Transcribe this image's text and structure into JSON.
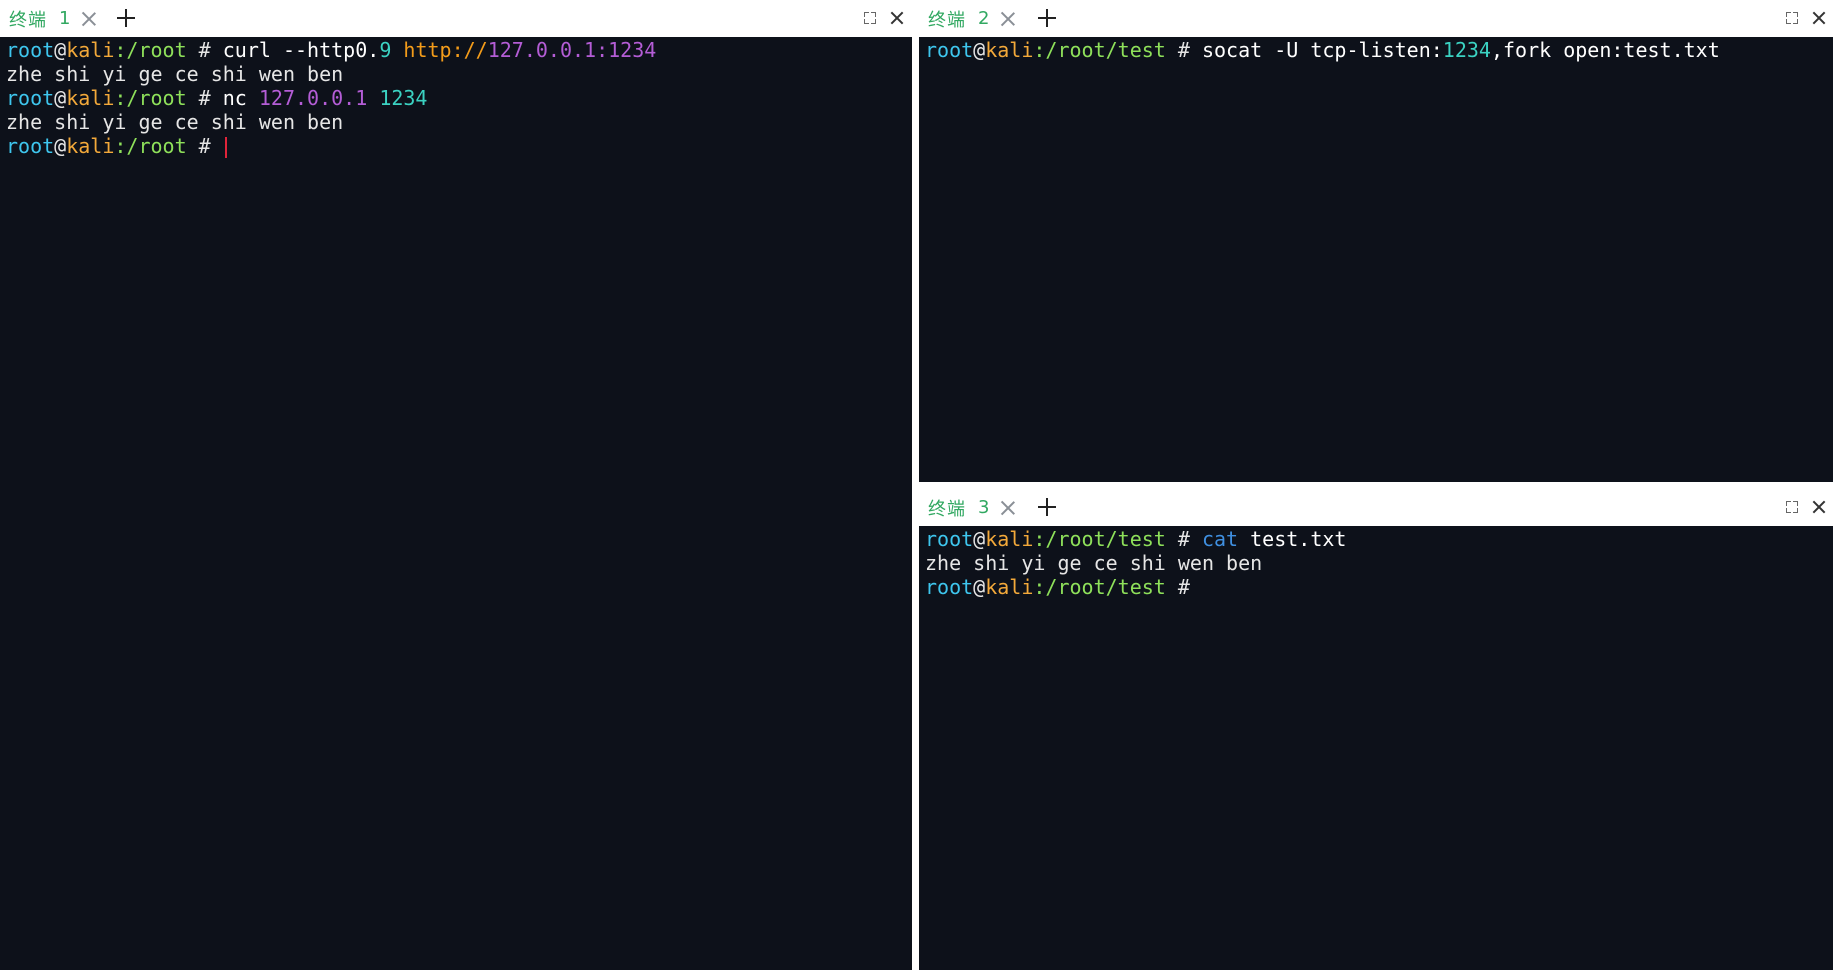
{
  "colors": {
    "terminal_bg": "#0d111a",
    "user": "#3ec6ee",
    "host": "#f3a93a",
    "path": "#8ee05a",
    "tab_label": "#31a861",
    "url": "#f39c1a",
    "ip": "#b45dd6",
    "number": "#3bd2c2",
    "keyword": "#3f8fe0",
    "cursor": "#e0243a"
  },
  "pane1": {
    "tab_label": "终端",
    "tab_number": "1",
    "lines": [
      {
        "prompt": {
          "user": "root",
          "at": "@",
          "host": "kali",
          "path": ":/root",
          "hash": " # "
        },
        "segments": [
          {
            "text": "curl --http0.",
            "style": "cmd"
          },
          {
            "text": "9",
            "style": "num"
          },
          {
            "text": " ",
            "style": "cmd"
          },
          {
            "text": "http://",
            "style": "url"
          },
          {
            "text": "127.0.0.1:1234",
            "style": "ip"
          }
        ]
      },
      {
        "output": "zhe shi yi ge ce shi wen ben"
      },
      {
        "prompt": {
          "user": "root",
          "at": "@",
          "host": "kali",
          "path": ":/root",
          "hash": " # "
        },
        "segments": [
          {
            "text": "nc ",
            "style": "cmd"
          },
          {
            "text": "127.0.0.1",
            "style": "ip"
          },
          {
            "text": " ",
            "style": "cmd"
          },
          {
            "text": "1234",
            "style": "num"
          }
        ]
      },
      {
        "output": "zhe shi yi ge ce shi wen ben"
      },
      {
        "prompt": {
          "user": "root",
          "at": "@",
          "host": "kali",
          "path": ":/root",
          "hash": " # "
        },
        "segments": [],
        "cursor": true
      }
    ]
  },
  "pane2": {
    "tab_label": "终端",
    "tab_number": "2",
    "lines": [
      {
        "prompt": {
          "user": "root",
          "at": "@",
          "host": "kali",
          "path": ":/root/test",
          "hash": " # "
        },
        "segments": [
          {
            "text": "socat -U tcp-listen:",
            "style": "cmd"
          },
          {
            "text": "1234",
            "style": "num"
          },
          {
            "text": ",fork open:test.txt",
            "style": "cmd"
          }
        ]
      }
    ]
  },
  "pane3": {
    "tab_label": "终端",
    "tab_number": "3",
    "lines": [
      {
        "prompt": {
          "user": "root",
          "at": "@",
          "host": "kali",
          "path": ":/root/test",
          "hash": " # "
        },
        "segments": [
          {
            "text": "cat",
            "style": "kw"
          },
          {
            "text": " test.txt",
            "style": "cmd"
          }
        ]
      },
      {
        "output": "zhe shi yi ge ce shi wen ben"
      },
      {
        "prompt": {
          "user": "root",
          "at": "@",
          "host": "kali",
          "path": ":/root/test",
          "hash": " #"
        },
        "segments": []
      }
    ]
  }
}
